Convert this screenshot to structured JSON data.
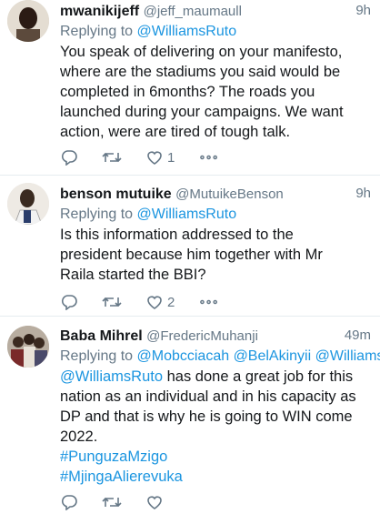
{
  "tweets": [
    {
      "name": "mwanikijeff",
      "handle": "@jeff_maumaull",
      "time": "9h",
      "replying_prefix": "Replying to ",
      "replying_to": "@WilliamsRuto",
      "text_lines": [
        "You speak of delivering on your manifesto,",
        "where are the stadiums you said would be",
        "completed in 6months? The roads you",
        "launched during your campaigns. We want",
        "action, were are tired of tough talk."
      ],
      "like_count": "1",
      "more": "∘∘∘",
      "avatar": "person-photo"
    },
    {
      "name": "benson mutuike",
      "handle": "@MutuikeBenson",
      "time": "9h",
      "replying_prefix": "Replying to ",
      "replying_to": "@WilliamsRuto",
      "text_lines": [
        "Is this information addressed to the",
        "president because him together with Mr",
        "Raila started the BBI?"
      ],
      "like_count": "2",
      "more": "∘∘∘",
      "avatar": "person-photo"
    },
    {
      "name": "Baba Mihrel",
      "handle": "@FredericMuhanji",
      "time": "49m",
      "replying_prefix": "Replying to ",
      "replying_to": "@Mobcciacah @BelAkinyii @Williams...",
      "text_mention": "@WilliamsRuto",
      "text_first_rest": " has done a great job for this",
      "text_lines": [
        "nation as an individual and in his capacity as",
        "DP and that is why he is going to WIN come",
        "2022."
      ],
      "hashtags": [
        "#PunguzaMzigo",
        "#MjingaAlierevuka"
      ],
      "avatar": "group-photo"
    }
  ],
  "colors": {
    "link": "#1b95e0",
    "muted": "#657786",
    "text": "#14171a",
    "divider": "#e6ecf0"
  }
}
